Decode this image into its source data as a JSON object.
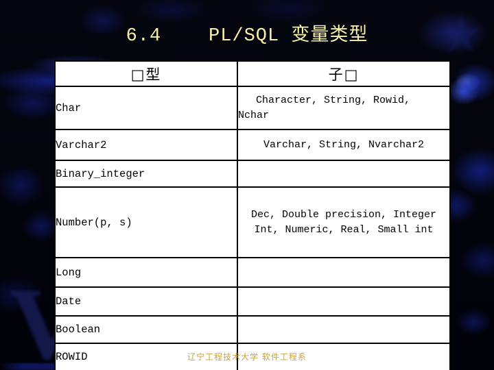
{
  "slide": {
    "title": "6.4    PL/SQL 变量类型",
    "title_color": "#F7F2A8",
    "background_color": "#03040c",
    "watermark_letter": "V",
    "footer": "辽宁工程技术大学 软件工程系",
    "footer_color": "#C9A23C"
  },
  "table": {
    "headers": {
      "type": "□型",
      "subtype": "子□"
    },
    "rows": [
      {
        "type": "Char",
        "subtype": "Character, String, Rowid,\nNchar"
      },
      {
        "type": "Varchar2",
        "subtype": "Varchar, String, Nvarchar2"
      },
      {
        "type": "Binary_integer",
        "subtype": ""
      },
      {
        "type": "Number(p, s)",
        "subtype": "Dec, Double precision, Integer\nInt, Numeric, Real, Small int"
      },
      {
        "type": "Long",
        "subtype": ""
      },
      {
        "type": "Date",
        "subtype": ""
      },
      {
        "type": "Boolean",
        "subtype": ""
      },
      {
        "type": "ROWID",
        "subtype": ""
      }
    ]
  }
}
